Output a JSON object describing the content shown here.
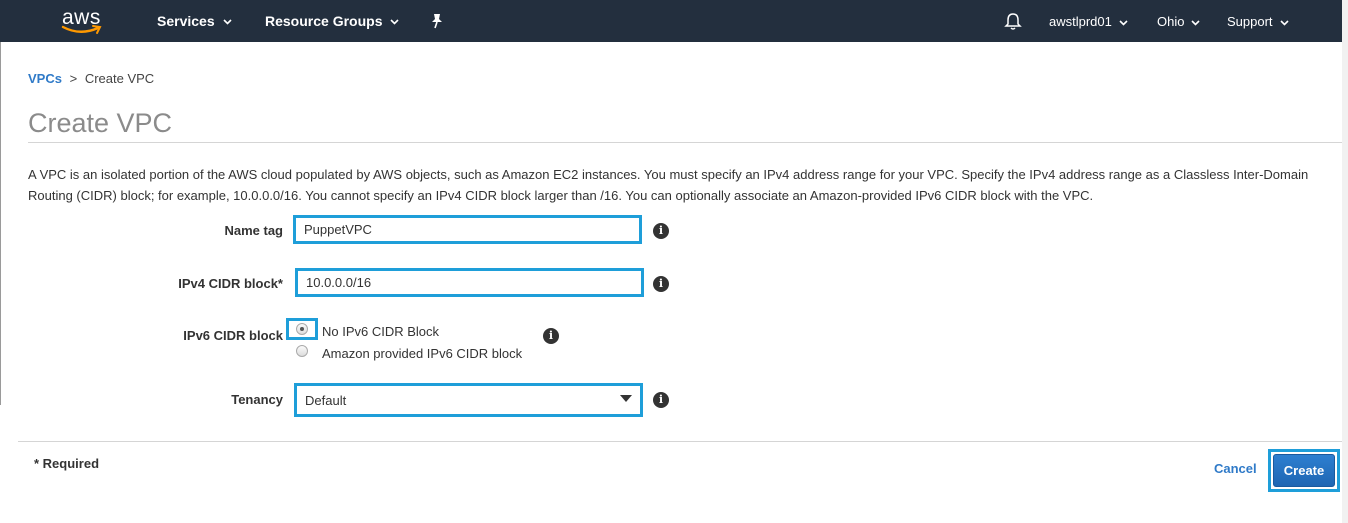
{
  "nav": {
    "logo_text": "aws",
    "services_label": "Services",
    "resource_groups_label": "Resource Groups",
    "account_label": "awstlprd01",
    "region_label": "Ohio",
    "support_label": "Support"
  },
  "breadcrumb": {
    "parent": "VPCs",
    "separator": ">",
    "current": "Create VPC"
  },
  "page": {
    "title": "Create VPC",
    "description": "A VPC is an isolated portion of the AWS cloud populated by AWS objects, such as Amazon EC2 instances. You must specify an IPv4 address range for your VPC. Specify the IPv4 address range as a Classless Inter-Domain Routing (CIDR) block; for example, 10.0.0.0/16. You cannot specify an IPv4 CIDR block larger than /16. You can optionally associate an Amazon-provided IPv6 CIDR block with the VPC."
  },
  "form": {
    "name_tag_label": "Name tag",
    "name_tag_value": "PuppetVPC",
    "ipv4_label": "IPv4 CIDR block*",
    "ipv4_value": "10.0.0.0/16",
    "ipv6_label": "IPv6 CIDR block",
    "ipv6_options": [
      {
        "label": "No IPv6 CIDR Block",
        "selected": true
      },
      {
        "label": "Amazon provided IPv6 CIDR block",
        "selected": false
      }
    ],
    "tenancy_label": "Tenancy",
    "tenancy_value": "Default",
    "info_glyph": "i"
  },
  "footer": {
    "required_note": "* Required",
    "cancel_label": "Cancel",
    "create_label": "Create"
  },
  "colors": {
    "nav_bg": "#232f3e",
    "highlight": "#1e9ed9",
    "link": "#2f7ac8",
    "aws_orange": "#ff9900"
  }
}
